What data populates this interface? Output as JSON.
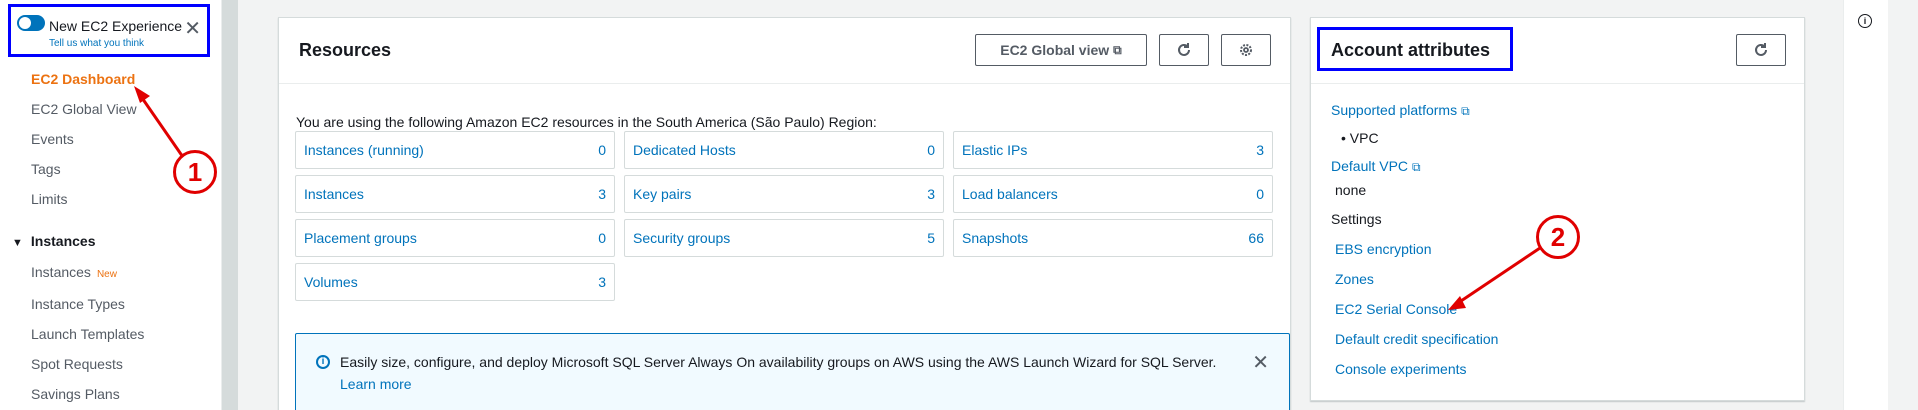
{
  "toggle": {
    "title": "New EC2 Experience",
    "subtitle": "Tell us what you think",
    "close": "✕"
  },
  "sidebar": {
    "items": [
      {
        "label": "EC2 Dashboard"
      },
      {
        "label": "EC2 Global View"
      },
      {
        "label": "Events"
      },
      {
        "label": "Tags"
      },
      {
        "label": "Limits"
      }
    ],
    "section": "Instances",
    "section_items": [
      {
        "label": "Instances",
        "badge": "New"
      },
      {
        "label": "Instance Types"
      },
      {
        "label": "Launch Templates"
      },
      {
        "label": "Spot Requests"
      },
      {
        "label": "Savings Plans"
      }
    ]
  },
  "resources": {
    "title": "Resources",
    "global_view_btn": "EC2 Global view",
    "intro": "You are using the following Amazon EC2 resources in the South America (São Paulo) Region:",
    "cells": [
      {
        "label": "Instances (running)",
        "value": "0"
      },
      {
        "label": "Dedicated Hosts",
        "value": "0"
      },
      {
        "label": "Elastic IPs",
        "value": "3"
      },
      {
        "label": "Instances",
        "value": "3"
      },
      {
        "label": "Key pairs",
        "value": "3"
      },
      {
        "label": "Load balancers",
        "value": "0"
      },
      {
        "label": "Placement groups",
        "value": "0"
      },
      {
        "label": "Security groups",
        "value": "5"
      },
      {
        "label": "Snapshots",
        "value": "66"
      },
      {
        "label": "Volumes",
        "value": "3"
      }
    ],
    "info_text": "Easily size, configure, and deploy Microsoft SQL Server Always On availability groups on AWS using the AWS Launch Wizard for SQL Server.",
    "info_link": "Learn more"
  },
  "account": {
    "title": "Account attributes",
    "supported_platforms": "Supported platforms",
    "platform_value": "VPC",
    "default_vpc": "Default VPC",
    "default_vpc_value": "none",
    "settings": "Settings",
    "links": [
      "EBS encryption",
      "Zones",
      "EC2 Serial Console",
      "Default credit specification",
      "Console experiments"
    ]
  },
  "annotations": {
    "one": "1",
    "two": "2",
    "color": "#e00000"
  }
}
